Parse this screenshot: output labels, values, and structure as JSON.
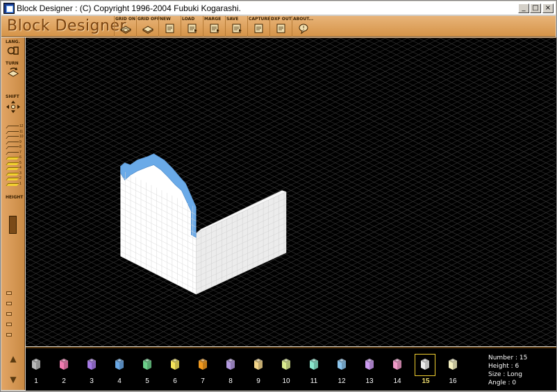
{
  "window": {
    "title": "Block Designer : (C) Copyright 1996-2004 Fubuki Kogarashi.",
    "minimize_glyph": "_",
    "maximize_glyph": "□",
    "close_glyph": "×"
  },
  "toolbar": {
    "logo": "Block Designer",
    "tools": [
      {
        "label": "GRID ON",
        "icon": "grid-on-icon"
      },
      {
        "label": "GRID OFF",
        "icon": "grid-off-icon"
      },
      {
        "label": "NEW",
        "icon": "new-file-icon"
      },
      {
        "label": "LOAD",
        "icon": "load-icon"
      },
      {
        "label": "MARGE",
        "icon": "merge-icon"
      },
      {
        "label": "SAVE",
        "icon": "save-icon"
      },
      {
        "label": "CAPTURE",
        "icon": "capture-icon"
      },
      {
        "label": "DXF OUT",
        "icon": "dxf-icon"
      },
      {
        "label": "ABOUT...",
        "icon": "about-icon"
      }
    ]
  },
  "leftpanel": {
    "lang_label": "LANG.",
    "turn_label": "TURN",
    "shift_label": "SHIFT",
    "height_label": "HEIGHT",
    "height_levels": [
      "12",
      "11",
      "10",
      "9",
      "8",
      "7",
      "6",
      "5",
      "4",
      "3",
      "2",
      "1"
    ],
    "height_selected": 6
  },
  "palette": {
    "colors": [
      {
        "num": "1",
        "color": "#b8b8b8"
      },
      {
        "num": "2",
        "color": "#f07ab0"
      },
      {
        "num": "3",
        "color": "#a67ae6"
      },
      {
        "num": "4",
        "color": "#6aa8e6"
      },
      {
        "num": "5",
        "color": "#6cd08a"
      },
      {
        "num": "6",
        "color": "#f2e25a"
      },
      {
        "num": "7",
        "color": "#f29a1e"
      },
      {
        "num": "8",
        "color": "#b49ae0"
      },
      {
        "num": "9",
        "color": "#f2d58a"
      },
      {
        "num": "10",
        "color": "#d8ea8e"
      },
      {
        "num": "11",
        "color": "#8ae6cc"
      },
      {
        "num": "12",
        "color": "#8cc6ee"
      },
      {
        "num": "13",
        "color": "#cc9af0"
      },
      {
        "num": "14",
        "color": "#f09ac8"
      },
      {
        "num": "15",
        "color": "#ececec"
      },
      {
        "num": "16",
        "color": "#f4f0c0"
      }
    ],
    "selected_index": 14
  },
  "info": {
    "number": "Number : 15",
    "height": "Height : 6",
    "size": "Size : Long",
    "angle": "Angle : 0"
  },
  "colors": {
    "block_white": "#f2f2f2",
    "block_blue": "#6aaae8",
    "grid": "#3a3a3a"
  }
}
